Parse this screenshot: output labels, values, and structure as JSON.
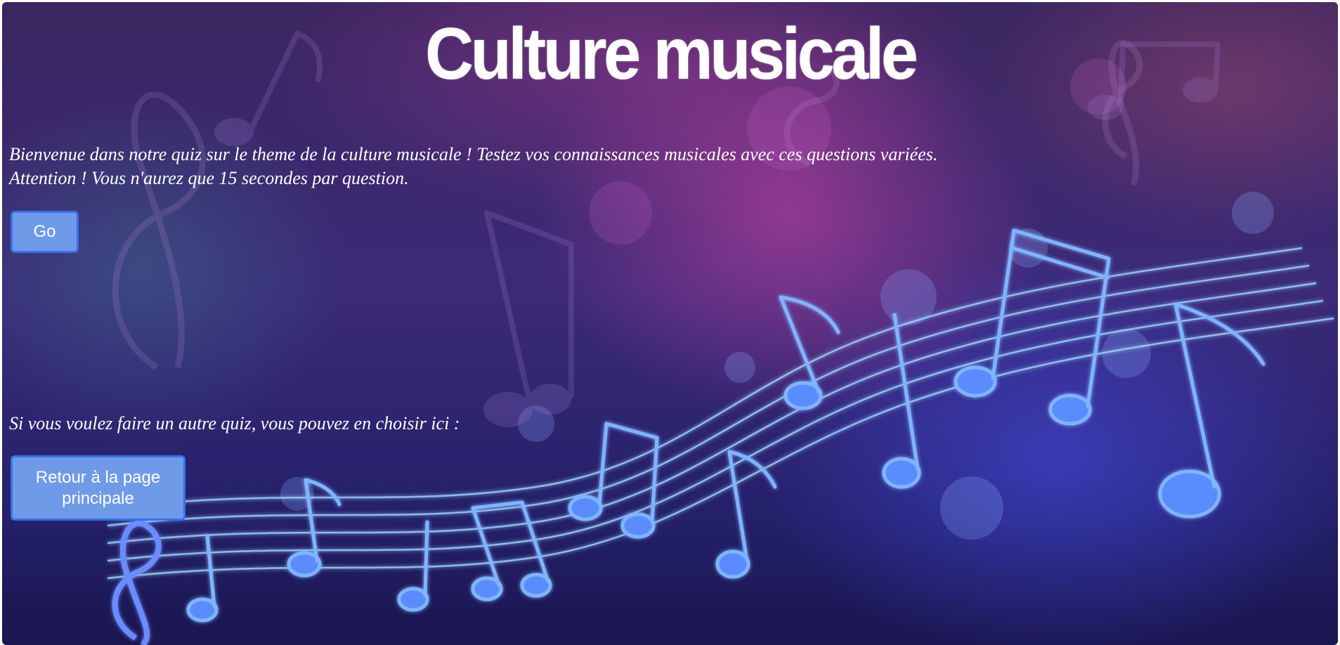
{
  "page": {
    "title": "Culture musicale",
    "intro_line1": "Bienvenue dans notre quiz sur le theme de la culture musicale ! Testez vos connaissances musicales avec ces questions variées.",
    "intro_line2": "Attention ! Vous n'aurez que 15 secondes par question.",
    "go_button_label": "Go",
    "other_quiz_text": "Si vous voulez faire un autre quiz, vous pouvez en choisir ici :",
    "back_button_label": "Retour à la page principale"
  },
  "background": {
    "image": "music-notes-staff-illustration"
  },
  "colors": {
    "button_fill": "#6f9ae8",
    "button_border": "#3a6ff0",
    "text": "#ffffff"
  }
}
